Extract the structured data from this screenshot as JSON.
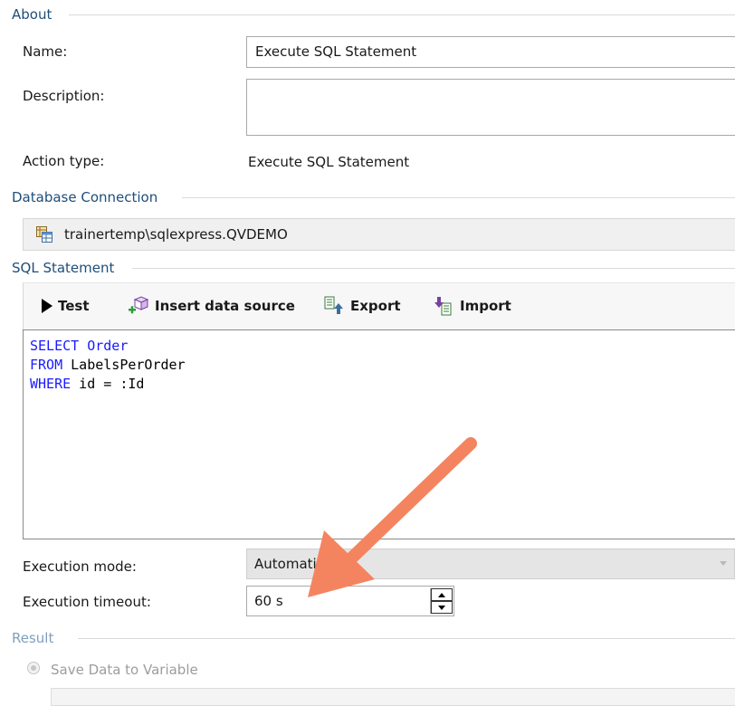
{
  "about": {
    "section_title": "About",
    "name_label": "Name:",
    "name_value": "Execute SQL Statement",
    "description_label": "Description:",
    "description_value": "",
    "action_type_label": "Action type:",
    "action_type_value": "Execute SQL Statement"
  },
  "database_connection": {
    "section_title": "Database Connection",
    "connection_value": "trainertemp\\sqlexpress.QVDEMO",
    "icon": "database-table-icon"
  },
  "sql_statement": {
    "section_title": "SQL Statement",
    "toolbar": {
      "test_label": "Test",
      "insert_label": "Insert data source",
      "export_label": "Export",
      "import_label": "Import"
    },
    "lines": [
      {
        "kw": "SELECT",
        "rest": " Order",
        "rest_is_kw": true
      },
      {
        "kw": "FROM",
        "rest": " LabelsPerOrder",
        "rest_is_kw": false
      },
      {
        "kw": "WHERE",
        "rest": " id = :Id",
        "rest_is_kw": false
      }
    ],
    "keyword_color": "#1a1aff"
  },
  "execution": {
    "mode_label": "Execution mode:",
    "mode_value": "Automatic",
    "timeout_label": "Execution timeout:",
    "timeout_value": "60 s"
  },
  "result": {
    "section_title": "Result",
    "save_radio_label": "Save Data to Variable"
  },
  "annotation": {
    "arrow_color": "#f4845f"
  }
}
